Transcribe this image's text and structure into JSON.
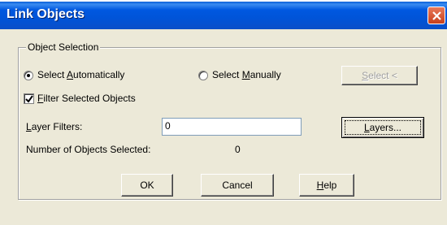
{
  "window": {
    "title": "Link Objects"
  },
  "group": {
    "label": "Object Selection"
  },
  "radios": {
    "automatic": {
      "prefix": "Select ",
      "accel": "A",
      "rest": "utomatically",
      "checked": true
    },
    "manual": {
      "prefix": "Select ",
      "accel": "M",
      "rest": "anually",
      "checked": false
    }
  },
  "select_button": {
    "accel": "S",
    "rest": "elect <"
  },
  "filter_checkbox": {
    "accel": "F",
    "rest": "ilter Selected Objects",
    "checked": true
  },
  "layer_filters": {
    "accel": "L",
    "rest": "ayer Filters:",
    "value": "0"
  },
  "layers_button": {
    "accel": "L",
    "rest": "ayers..."
  },
  "objects_selected": {
    "label": "Number of Objects Selected:",
    "count": "0"
  },
  "buttons": {
    "ok": "OK",
    "cancel": "Cancel",
    "help_accel": "H",
    "help_rest": "elp"
  }
}
